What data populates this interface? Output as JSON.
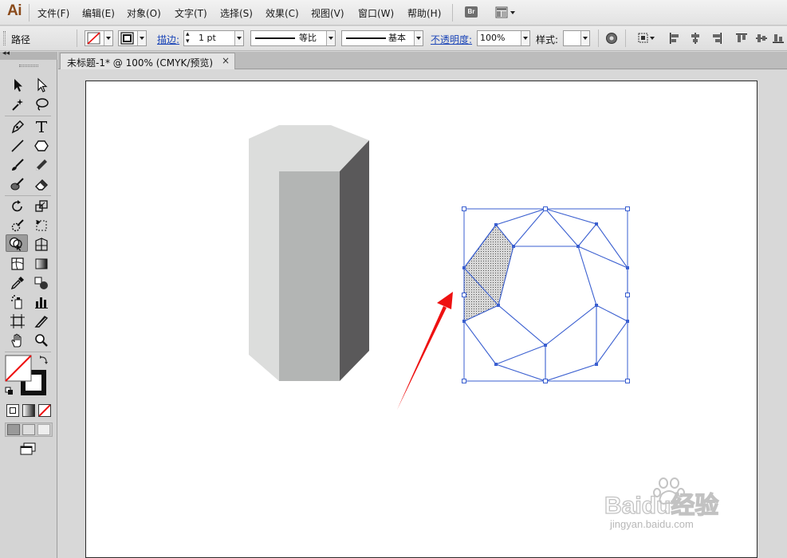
{
  "app": {
    "logo_text": "Ai",
    "menu": [
      "文件(F)",
      "编辑(E)",
      "对象(O)",
      "文字(T)",
      "选择(S)",
      "效果(C)",
      "视图(V)",
      "窗口(W)",
      "帮助(H)"
    ],
    "bridge_label": "Br"
  },
  "control_bar": {
    "object_type": "路径",
    "stroke_label": "描边:",
    "stroke_weight": "1 pt",
    "profile_label": "等比",
    "brush_label": "基本",
    "opacity_label": "不透明度:",
    "opacity_value": "100%",
    "style_label": "样式:"
  },
  "document": {
    "tab_title": "未标题-1* @ 100% (CMYK/预览)",
    "close_glyph": "×"
  },
  "toolbox": {
    "collapse_glyph": "◂◂",
    "tools": [
      "selection-tool",
      "direct-selection-tool",
      "magic-wand-tool",
      "lasso-tool",
      "pen-tool",
      "type-tool",
      "line-tool",
      "polygon-tool",
      "paintbrush-tool",
      "pencil-tool",
      "blob-brush-tool",
      "eraser-tool",
      "rotate-tool",
      "scale-tool",
      "warp-tool",
      "free-transform-tool",
      "shape-builder-tool",
      "perspective-grid-tool",
      "mesh-tool",
      "gradient-tool",
      "eyedropper-tool",
      "blend-tool",
      "symbol-sprayer-tool",
      "column-graph-tool",
      "artboard-tool",
      "slice-tool",
      "hand-tool",
      "zoom-tool"
    ]
  },
  "watermark": {
    "brand_text": "Baidu经验",
    "url_text": "jingyan.baidu.com"
  },
  "colors": {
    "selection_blue": "#3a5fd0",
    "arrow_red": "#ee1111",
    "prism_left": "#dcdddc",
    "prism_mid": "#b3b5b4",
    "prism_right": "#5a595a"
  }
}
